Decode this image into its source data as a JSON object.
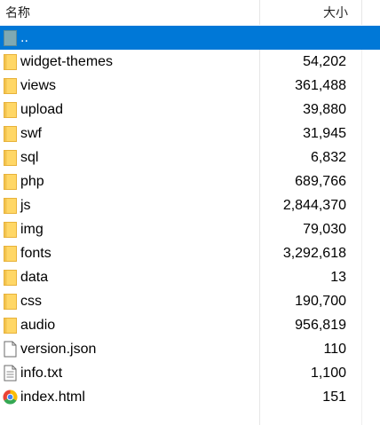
{
  "columns": {
    "name": "名称",
    "size": "大小"
  },
  "rows": [
    {
      "name": "..",
      "size": "",
      "icon": "folder-up-icon",
      "selected": true
    },
    {
      "name": "widget-themes",
      "size": "54,202",
      "icon": "folder-icon"
    },
    {
      "name": "views",
      "size": "361,488",
      "icon": "folder-icon"
    },
    {
      "name": "upload",
      "size": "39,880",
      "icon": "folder-icon"
    },
    {
      "name": "swf",
      "size": "31,945",
      "icon": "folder-icon"
    },
    {
      "name": "sql",
      "size": "6,832",
      "icon": "folder-icon"
    },
    {
      "name": "php",
      "size": "689,766",
      "icon": "folder-icon"
    },
    {
      "name": "js",
      "size": "2,844,370",
      "icon": "folder-icon"
    },
    {
      "name": "img",
      "size": "79,030",
      "icon": "folder-icon"
    },
    {
      "name": "fonts",
      "size": "3,292,618",
      "icon": "folder-icon"
    },
    {
      "name": "data",
      "size": "13",
      "icon": "folder-icon"
    },
    {
      "name": "css",
      "size": "190,700",
      "icon": "folder-icon"
    },
    {
      "name": "audio",
      "size": "956,819",
      "icon": "folder-icon"
    },
    {
      "name": "version.json",
      "size": "110",
      "icon": "file-icon"
    },
    {
      "name": "info.txt",
      "size": "1,100",
      "icon": "text-file-icon"
    },
    {
      "name": "index.html",
      "size": "151",
      "icon": "chrome-html-icon"
    }
  ],
  "colors": {
    "selection": "#0078d7",
    "folder": "#ffd766",
    "folder_dark": "#e8b23a"
  }
}
